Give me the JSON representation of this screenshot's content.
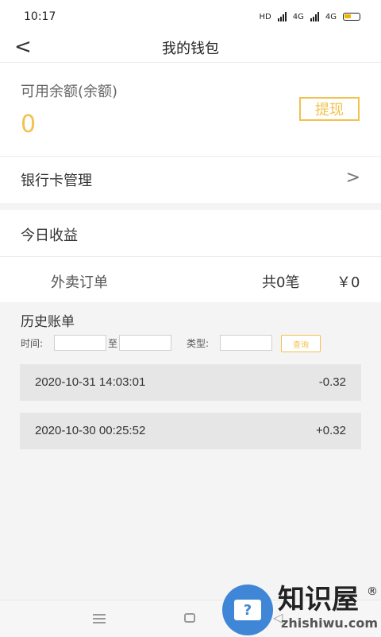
{
  "status_bar": {
    "time": "10:17",
    "network": "HD",
    "signal_1": "4G",
    "signal_2": "4G"
  },
  "nav": {
    "title": "我的钱包"
  },
  "balance": {
    "label": "可用余额(余额)",
    "value": "0",
    "withdraw_label": "提现"
  },
  "bank": {
    "label": "银行卡管理"
  },
  "today": {
    "title": "今日收益",
    "takeout": {
      "label": "外卖订单",
      "count": "共0笔",
      "amount": "￥0"
    }
  },
  "history": {
    "title": "历史账单",
    "filter": {
      "time_label": "时间:",
      "to_label": "至",
      "type_label": "类型:",
      "query_label": "查询"
    },
    "records": [
      {
        "date": "2020-10-31 14:03:01",
        "amount": "-0.32"
      },
      {
        "date": "2020-10-30 00:25:52",
        "amount": "+0.32"
      }
    ]
  },
  "watermark": {
    "text": "知识屋",
    "url": "zhishiwu.com",
    "reg": "®"
  },
  "colors": {
    "accent": "#f2c14e",
    "watermark_blue": "#3f86d6"
  }
}
